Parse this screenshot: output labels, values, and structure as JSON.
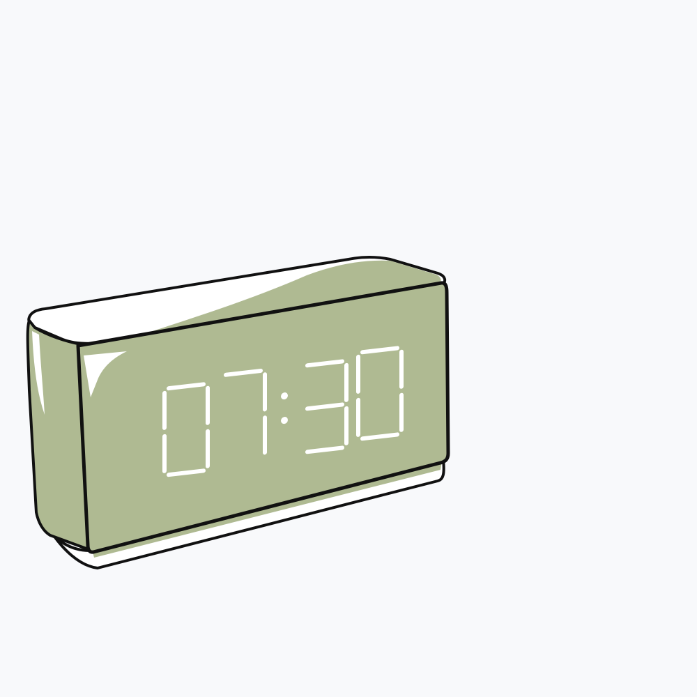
{
  "clock": {
    "display_time": "07:30",
    "digits": [
      "0",
      "7",
      "3",
      "0"
    ],
    "separator": ":"
  },
  "colors": {
    "background": "#f8f9fb",
    "body": "#afba92",
    "outline": "#111111",
    "segment": "#ffffff",
    "highlight": "#ffffff"
  }
}
